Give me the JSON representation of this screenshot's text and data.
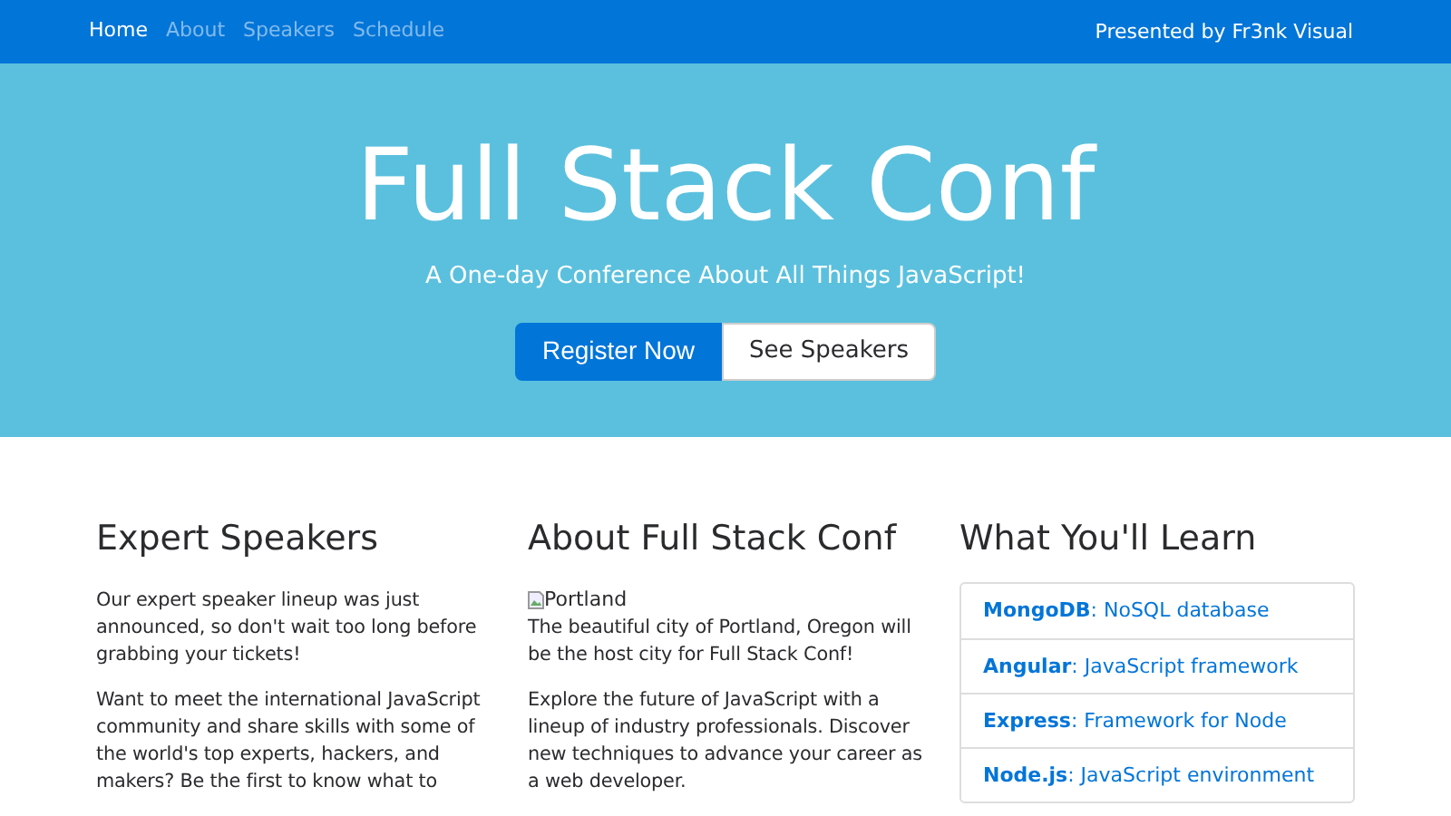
{
  "navbar": {
    "links": [
      {
        "label": "Home",
        "selected": true
      },
      {
        "label": "About",
        "selected": false
      },
      {
        "label": "Speakers",
        "selected": false
      },
      {
        "label": "Schedule",
        "selected": false
      }
    ],
    "credit": "Presented by Fr3nk Visual"
  },
  "hero": {
    "title": "Full Stack Conf",
    "subtitle": "A One-day Conference About All Things JavaScript!",
    "buttons": [
      {
        "label": "Register Now",
        "kind": "primary"
      },
      {
        "label": "See Speakers",
        "kind": "light"
      }
    ]
  },
  "columns": [
    {
      "heading": "Expert Speakers",
      "paragraphs": [
        "Our expert speaker lineup was just announced, so don't wait too long before grabbing your tickets!",
        "Want to meet the international JavaScript community and share skills with some of the world's top experts, hackers, and makers? Be the first to know what to"
      ]
    },
    {
      "heading": "About Full Stack Conf",
      "image_alt": "Portland",
      "paragraphs": [
        "The beautiful city of Portland, Oregon will be the host city for Full Stack Conf!",
        "Explore the future of JavaScript with a lineup of industry professionals. Discover new techniques to advance your career as a web developer."
      ]
    },
    {
      "heading": "What You'll Learn",
      "items": [
        "**MongoDB**: NoSQL database",
        "**Angular**: JavaScript framework",
        "**Express**: Framework for Node",
        "**Node.js**: JavaScript environment"
      ]
    }
  ]
}
